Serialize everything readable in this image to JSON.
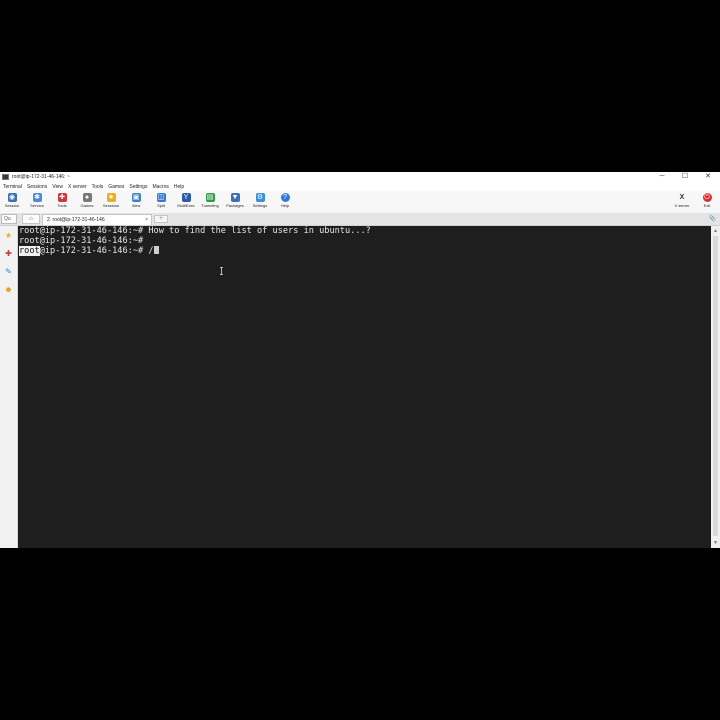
{
  "window": {
    "title": "root@ip-172-31-46-146: ~",
    "controls": [
      "─",
      "☐",
      "✕"
    ]
  },
  "menu": [
    "Terminal",
    "Sessions",
    "View",
    "X server",
    "Tools",
    "Games",
    "Settings",
    "Macros",
    "Help"
  ],
  "toolbar": {
    "items": [
      {
        "label": "Session",
        "icon": "session-icon",
        "color": "#3b6fb5",
        "glyph": "◉"
      },
      {
        "label": "Servers",
        "icon": "servers-icon",
        "color": "#4a8ad8",
        "glyph": "✱"
      },
      {
        "label": "Tools",
        "icon": "tools-icon",
        "color": "#c83a3a",
        "glyph": "✚"
      },
      {
        "label": "Games",
        "icon": "games-icon",
        "color": "#777777",
        "glyph": "♠"
      },
      {
        "label": "Sessions",
        "icon": "star-icon",
        "color": "#e8b020",
        "glyph": "★"
      },
      {
        "label": "View",
        "icon": "view-icon",
        "color": "#3f7fc8",
        "glyph": "▣"
      },
      {
        "label": "Split",
        "icon": "split-icon",
        "color": "#3a78d0",
        "glyph": "◫"
      },
      {
        "label": "MultiExec",
        "icon": "multiexec-icon",
        "color": "#2d5aa8",
        "glyph": "Y"
      },
      {
        "label": "Tunneling",
        "icon": "tunneling-icon",
        "color": "#2f9a4a",
        "glyph": "▤"
      },
      {
        "label": "Packages",
        "icon": "packages-icon",
        "color": "#3d6fb8",
        "glyph": "▼"
      },
      {
        "label": "Settings",
        "icon": "settings-icon",
        "color": "#3b8fd8",
        "glyph": "⚙"
      },
      {
        "label": "Help",
        "icon": "help-icon",
        "color": "#2f7ad8",
        "glyph": "?"
      }
    ],
    "right": [
      {
        "label": "X server",
        "icon": "x-server-icon",
        "color": "#333333",
        "glyph": "X"
      },
      {
        "label": "Exit",
        "icon": "exit-icon",
        "color": "#d83030",
        "glyph": "⏻"
      }
    ]
  },
  "tabs": {
    "quick_connect": "Qu",
    "home_icon": "⌂",
    "active_tab": "2. root@ip-172-31-46-146",
    "close_glyph": "×",
    "new_tab_glyph": "+",
    "pin_glyph": "📎"
  },
  "sidebar": [
    {
      "icon": "star-icon",
      "glyph": "★",
      "color": "#e8b020"
    },
    {
      "icon": "tools-icon",
      "glyph": "✚",
      "color": "#c83a3a"
    },
    {
      "icon": "macros-icon",
      "glyph": "✎",
      "color": "#3b7fd8"
    },
    {
      "icon": "smiley-icon",
      "glyph": "☻",
      "color": "#e89a20"
    }
  ],
  "terminal": {
    "lines": [
      {
        "prompt": "root@ip-172-31-46-146:~# ",
        "text": "How to find the list of users in ubuntu...?"
      },
      {
        "prompt": "root@ip-172-31-46-146:~# ",
        "text": ""
      },
      {
        "selected": "root",
        "prompt_rest": "@ip-172-31-46-146:~# ",
        "text": "/"
      }
    ]
  },
  "colors": {
    "terminal_bg": "#1e1e1e",
    "terminal_fg": "#e6e6e6",
    "chrome_bg": "#f0f0f0"
  }
}
